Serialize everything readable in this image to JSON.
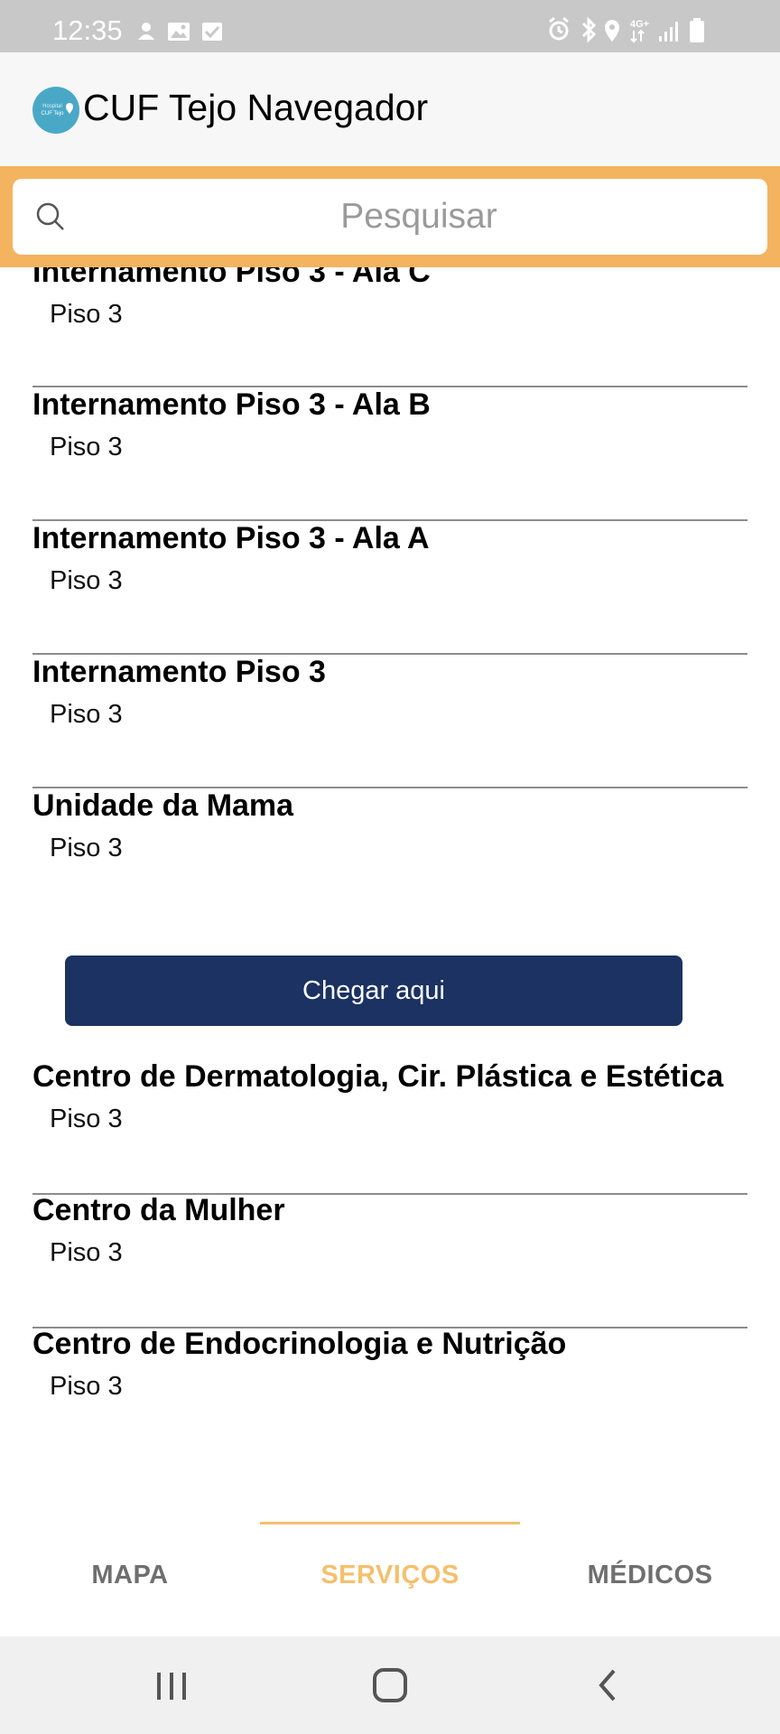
{
  "status_bar": {
    "time": "12:35",
    "left_icons": [
      "notification-icon",
      "image-icon",
      "check-icon"
    ],
    "right_icons": [
      "alarm-icon",
      "bluetooth-icon",
      "location-icon",
      "4g-icon",
      "signal-icon",
      "battery-icon"
    ],
    "network_label": "4G+"
  },
  "header": {
    "title": "CUF Tejo Navegador",
    "logo_text": "Hospital CUF Tejo",
    "logo_color": "#4aa8c7"
  },
  "search": {
    "placeholder": "Pesquisar",
    "value": "",
    "band_color": "#f4b35f"
  },
  "list": {
    "items": [
      {
        "title": "Internamento Piso 3 - Ala C",
        "floor": "Piso 3"
      },
      {
        "title": "Internamento Piso 3 - Ala B",
        "floor": "Piso 3"
      },
      {
        "title": "Internamento Piso 3 - Ala A",
        "floor": "Piso 3"
      },
      {
        "title": "Internamento Piso 3",
        "floor": "Piso 3"
      },
      {
        "title": "Unidade da Mama",
        "floor": "Piso 3"
      },
      {
        "title": "Centro de Dermatologia, Cir. Plástica e Estética",
        "floor": "Piso 3"
      },
      {
        "title": "Centro da Mulher",
        "floor": "Piso 3"
      },
      {
        "title": "Centro de Endocrinologia e Nutrição",
        "floor": "Piso 3"
      }
    ],
    "expanded_action": {
      "label": "Chegar aqui",
      "color": "#1b3262"
    }
  },
  "tabs": {
    "items": [
      {
        "label": "MAPA",
        "active": false
      },
      {
        "label": "SERVIÇOS",
        "active": true
      },
      {
        "label": "MÉDICOS",
        "active": false
      }
    ],
    "active_color": "#f4c06e",
    "inactive_color": "#6f6f6f"
  },
  "nav_bar": {
    "buttons": [
      "recent-apps-icon",
      "home-icon",
      "back-icon"
    ]
  }
}
